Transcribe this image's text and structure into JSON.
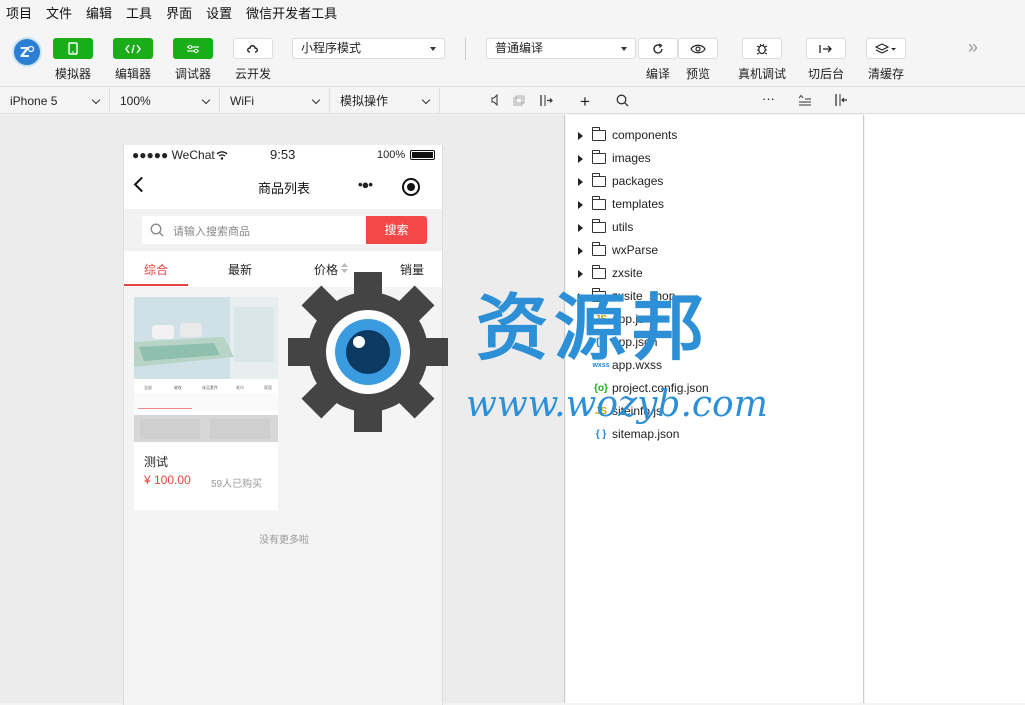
{
  "menubar": {
    "items": [
      "项目",
      "文件",
      "编辑",
      "工具",
      "界面",
      "设置",
      "微信开发者工具"
    ]
  },
  "toolbar": {
    "simulator": "模拟器",
    "editor": "编辑器",
    "debugger": "调试器",
    "cloud": "云开发",
    "mode_select": "小程序模式",
    "compile_select": "普通编译",
    "compile": "编译",
    "preview": "预览",
    "real_debug": "真机调试",
    "background": "切后台",
    "clear_cache": "清缓存"
  },
  "devbar": {
    "device": "iPhone 5",
    "zoom": "100%",
    "network": "WiFi",
    "simulate_op": "模拟操作"
  },
  "phone": {
    "status": {
      "carrier": "●●●●● WeChat",
      "time": "9:53",
      "battery": "100%"
    },
    "nav_title": "商品列表",
    "search_placeholder": "请输入搜索商品",
    "search_button": "搜索",
    "tabs": [
      "综合",
      "最新",
      "价格",
      "销量"
    ],
    "product": {
      "name": "测试",
      "price": "¥ 100.00",
      "sold": "59人已购买"
    },
    "footer": "没有更多啦"
  },
  "filetree": {
    "folders": [
      "components",
      "images",
      "packages",
      "templates",
      "utils",
      "wxParse",
      "zxsite",
      "zxsite_shop"
    ],
    "files": [
      {
        "icon": "JS",
        "name": "app.js",
        "color": "#c9a400"
      },
      {
        "icon": "{ }",
        "name": "app.json",
        "color": "#1e88e5"
      },
      {
        "icon": "wxss",
        "name": "app.wxss",
        "color": "#1e88e5"
      },
      {
        "icon": "{o}",
        "name": "project.config.json",
        "color": "#1aad19"
      },
      {
        "icon": "JS",
        "name": "siteinfo.js",
        "color": "#c9a400"
      },
      {
        "icon": "{ }",
        "name": "sitemap.json",
        "color": "#1e88e5"
      }
    ]
  },
  "watermark": {
    "text": "资源邦",
    "url": "www.wozyb.com"
  },
  "colors": {
    "accent_green": "#1aad19",
    "accent_red": "#e64340",
    "watermark_blue": "#2d8fd6"
  }
}
